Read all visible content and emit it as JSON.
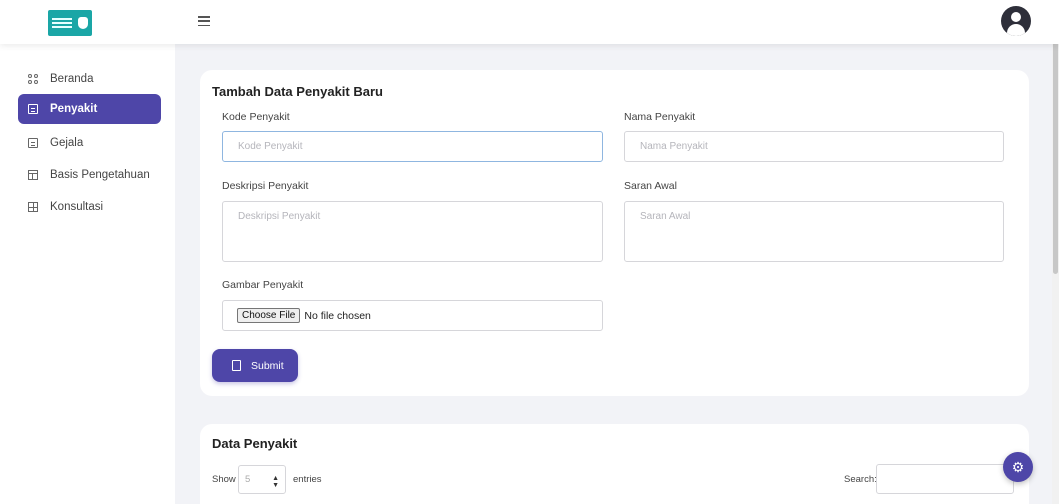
{
  "header": {
    "menu_icon": "hamburger-icon",
    "avatar_icon": "user-circle-icon"
  },
  "sidebar": {
    "items": [
      {
        "label": "Beranda",
        "icon": "grid-icon"
      },
      {
        "label": "Penyakit",
        "icon": "document-icon",
        "active": true
      },
      {
        "label": "Gejala",
        "icon": "document-icon"
      },
      {
        "label": "Basis Pengetahuan",
        "icon": "table-icon"
      },
      {
        "label": "Konsultasi",
        "icon": "grid-plus-icon"
      }
    ]
  },
  "form": {
    "title": "Tambah Data Penyakit Baru",
    "kode": {
      "label": "Kode Penyakit",
      "placeholder": "Kode Penyakit",
      "value": ""
    },
    "nama": {
      "label": "Nama Penyakit",
      "placeholder": "Nama Penyakit",
      "value": ""
    },
    "deskripsi": {
      "label": "Deskripsi Penyakit",
      "placeholder": "Deskripsi Penyakit",
      "value": ""
    },
    "saran": {
      "label": "Saran Awal",
      "placeholder": "Saran Awal",
      "value": ""
    },
    "gambar": {
      "label": "Gambar Penyakit",
      "button_label": "Choose File",
      "status": "No file chosen"
    },
    "submit_label": "Submit"
  },
  "table_section": {
    "title": "Data Penyakit",
    "show_label": "Show",
    "entries_value": "5",
    "entries_label": "entries",
    "search_label": "Search:",
    "search_value": ""
  },
  "colors": {
    "accent": "#4e46a8",
    "background": "#f2f3f7"
  }
}
